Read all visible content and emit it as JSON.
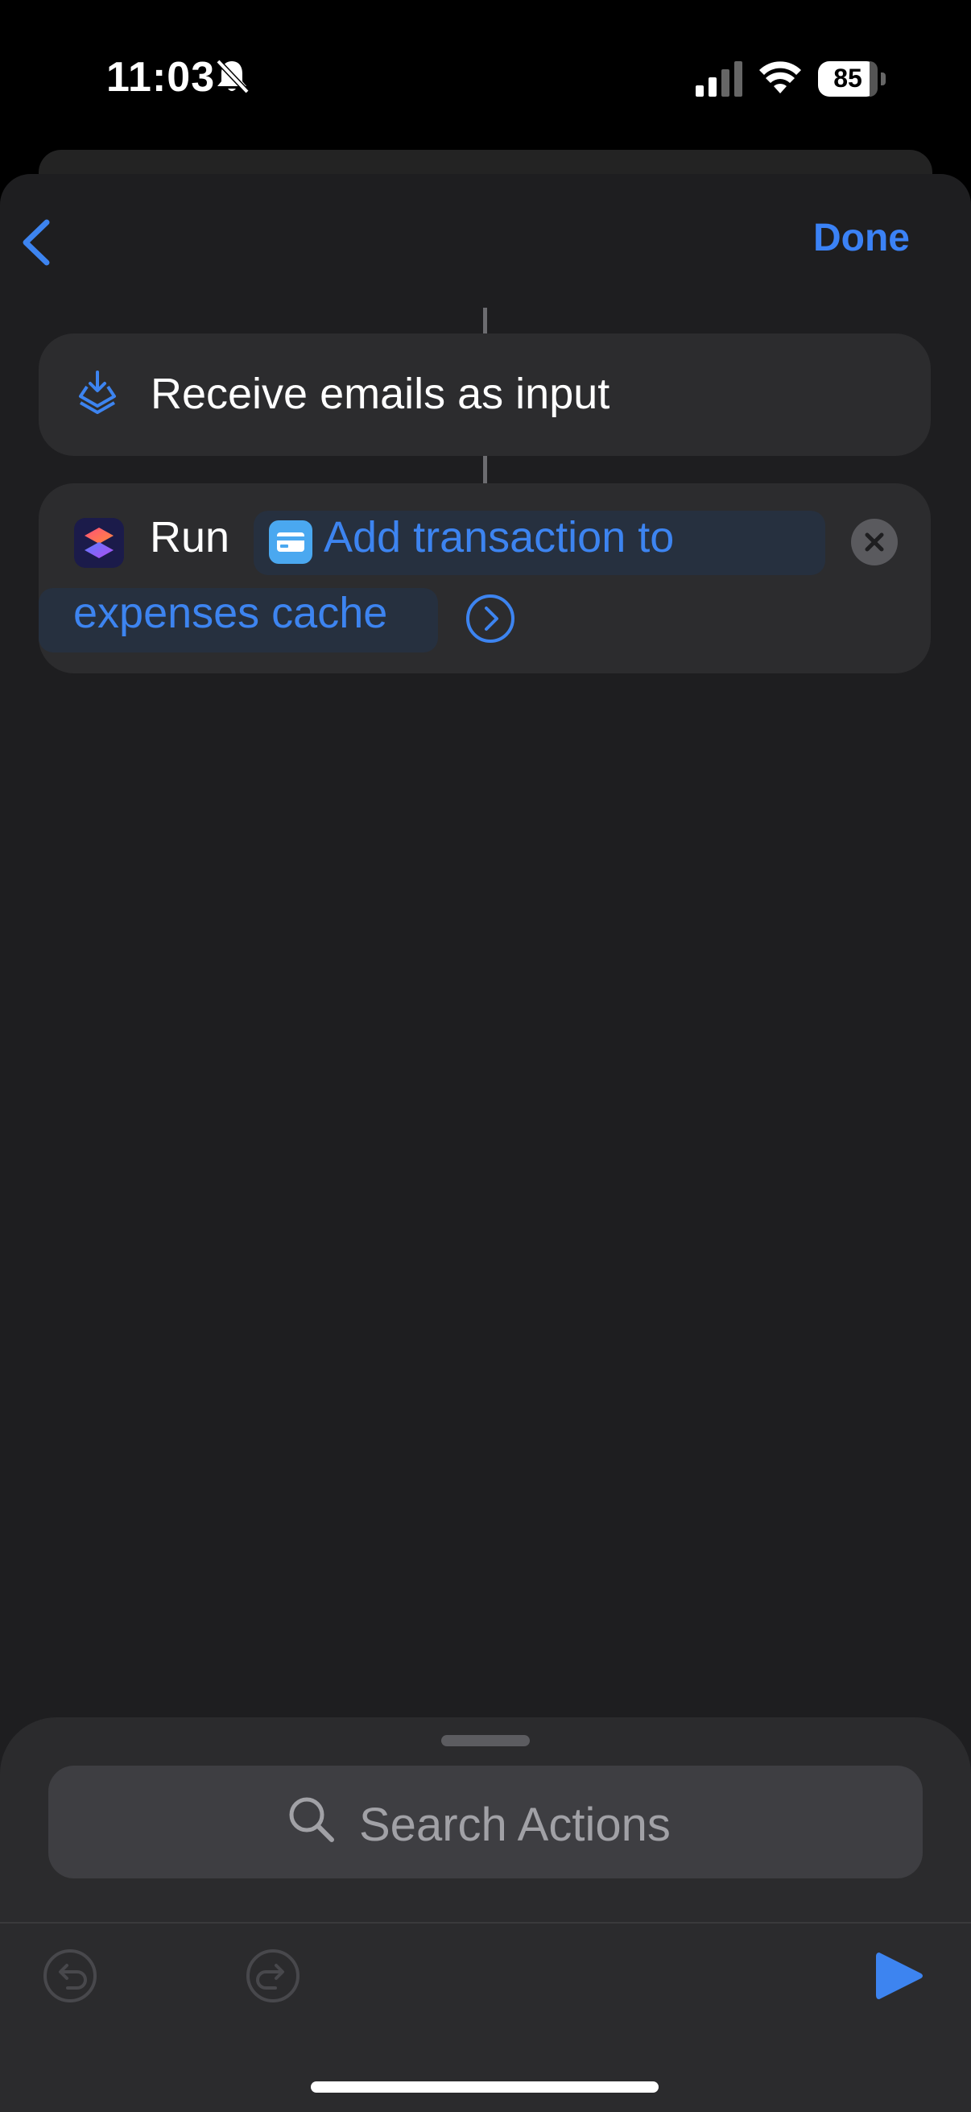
{
  "status": {
    "time": "11:03",
    "battery": "85",
    "battery_level": 0.85,
    "icons": [
      "bell-slash-icon",
      "cellular-signal-icon",
      "wifi-icon",
      "battery-icon"
    ]
  },
  "nav": {
    "back_icon": "chevron-left-icon",
    "done_label": "Done"
  },
  "actions": [
    {
      "icon": "receive-input-icon",
      "label": "Receive emails as input"
    },
    {
      "icon": "shortcuts-app-icon",
      "label": "Run",
      "shortcut_icon": "credit-card-icon",
      "shortcut_name_line1": "Add transaction to",
      "shortcut_name_line2": "expenses cache",
      "clear_icon": "clear-x-icon",
      "expand_icon": "chevron-right-circle-icon"
    }
  ],
  "search": {
    "placeholder": "Search Actions",
    "icon": "magnifier-icon"
  },
  "toolbar": {
    "undo_icon": "undo-icon",
    "redo_icon": "redo-icon",
    "play_icon": "play-icon"
  },
  "colors": {
    "accent": "#3d84f0",
    "background": "#1e1e20",
    "card": "#2c2c2e"
  }
}
